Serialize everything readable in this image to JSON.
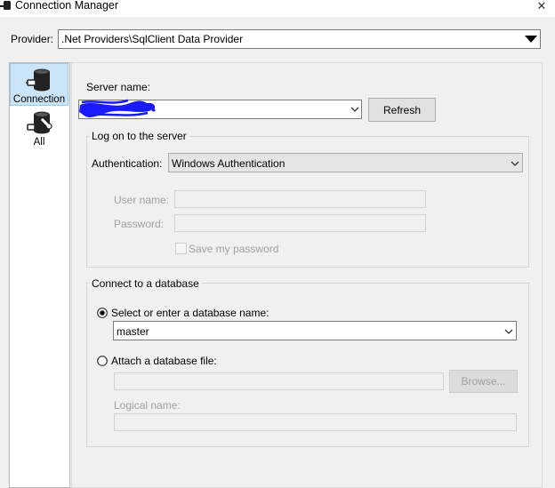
{
  "window": {
    "title": "Connection Manager",
    "close_glyph": "✕"
  },
  "provider": {
    "label": "Provider:",
    "value": ".Net Providers\\SqlClient Data Provider"
  },
  "nav": {
    "items": [
      {
        "label": "Connection",
        "icon": "database-plug-icon",
        "selected": true
      },
      {
        "label": "All",
        "icon": "database-wrench-icon",
        "selected": false
      }
    ]
  },
  "server": {
    "label": "Server name:",
    "value": "",
    "redacted": true,
    "refresh_label": "Refresh"
  },
  "logon": {
    "group_title": "Log on to the server",
    "auth_label": "Authentication:",
    "auth_value": "Windows Authentication",
    "username_label": "User name:",
    "password_label": "Password:",
    "save_password_label": "Save my password",
    "save_password_checked": false
  },
  "database": {
    "group_title": "Connect to a database",
    "select_label": "Select or enter a database name:",
    "select_checked": true,
    "database_value": "master",
    "attach_label": "Attach a database file:",
    "attach_checked": false,
    "browse_label": "Browse...",
    "logical_name_label": "Logical name:"
  },
  "colors": {
    "selection_bg": "#cce4f7",
    "redaction": "#1a1aff",
    "panel_bg": "#f0f0f0"
  }
}
